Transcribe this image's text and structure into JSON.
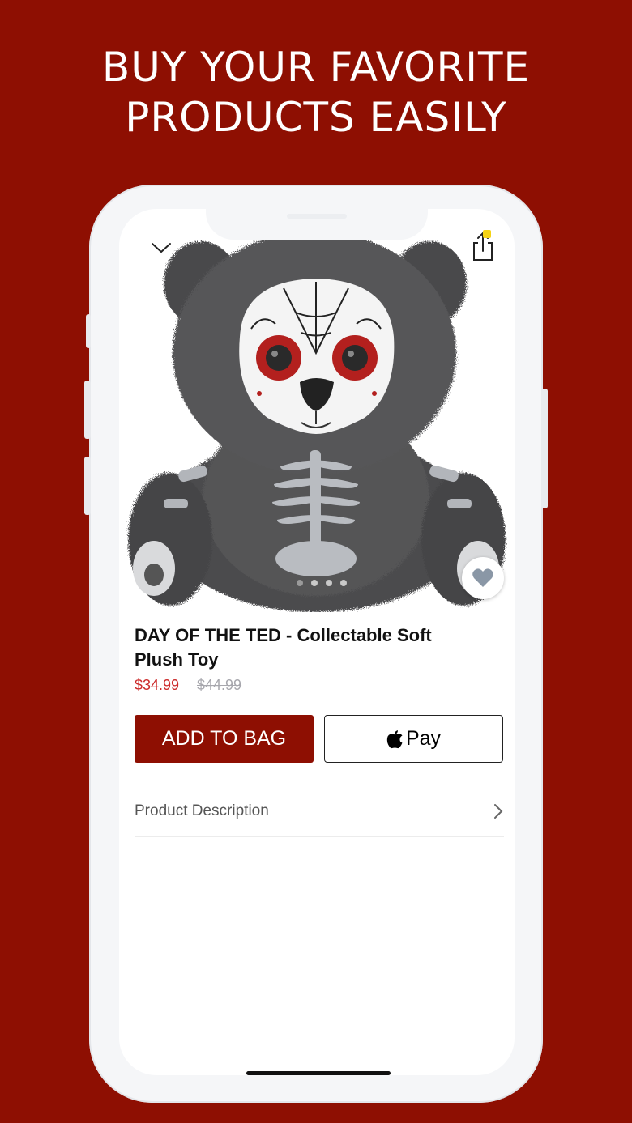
{
  "headline": {
    "line1": "BUY YOUR FAVORITE",
    "line2": "PRODUCTS EASILY"
  },
  "colors": {
    "brand": "#8e0f02",
    "sale_price": "#cc2b2b",
    "old_price": "#a7a7ad",
    "badge": "#f5d313"
  },
  "product": {
    "title": "DAY OF THE TED - Collectable Soft Plush Toy",
    "sale_price": "$34.99",
    "original_price": "$44.99",
    "image_dots": 4,
    "active_image": 1
  },
  "actions": {
    "add_to_bag": "ADD TO BAG",
    "apple_pay": "Pay"
  },
  "sections": [
    {
      "label": "Product Description",
      "icon": "chevron-right-icon"
    }
  ],
  "icons": {
    "close": "chevron-down-icon",
    "share": "share-icon",
    "favorite": "heart-icon",
    "apple": "apple-logo-icon"
  }
}
